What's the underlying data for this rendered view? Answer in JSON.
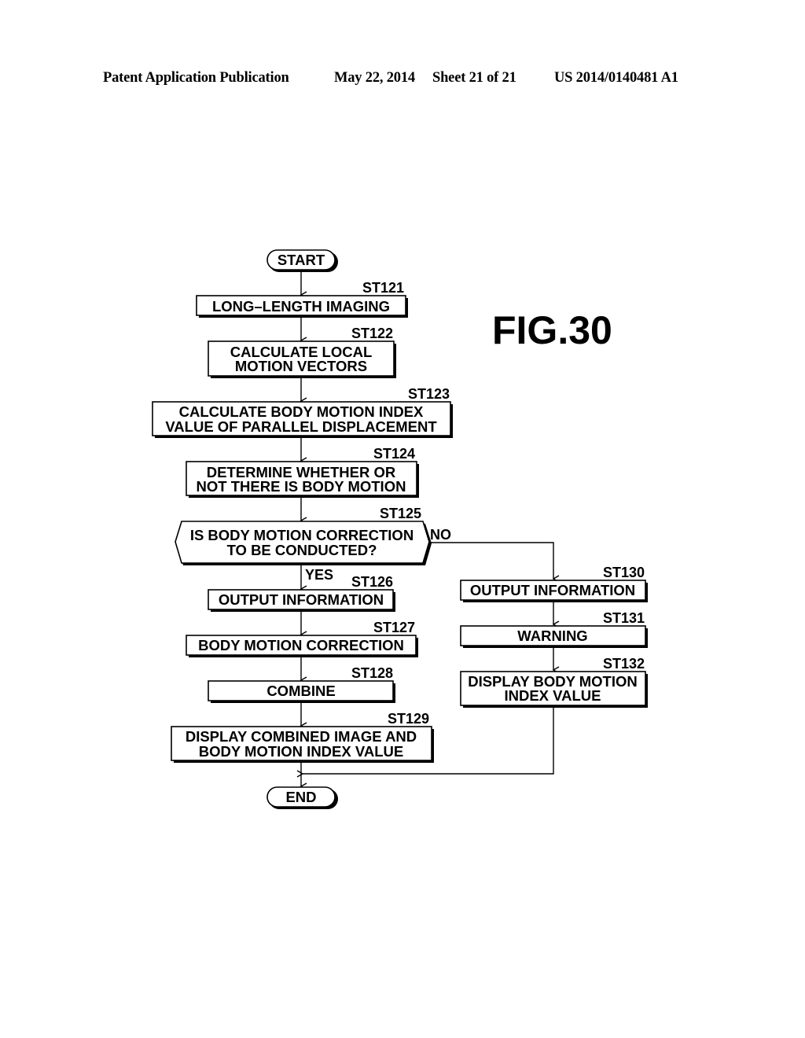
{
  "header": {
    "publication": "Patent Application Publication",
    "date": "May 22, 2014",
    "sheet": "Sheet 21 of 21",
    "number": "US 2014/0140481 A1"
  },
  "figure_label": "FIG.30",
  "flowchart": {
    "start": "START",
    "end": "END",
    "steps": {
      "st121": {
        "id": "ST121",
        "lines": [
          "LONG–LENGTH IMAGING"
        ]
      },
      "st122": {
        "id": "ST122",
        "lines": [
          "CALCULATE LOCAL",
          "MOTION VECTORS"
        ]
      },
      "st123": {
        "id": "ST123",
        "lines": [
          "CALCULATE BODY MOTION INDEX",
          "VALUE OF PARALLEL DISPLACEMENT"
        ]
      },
      "st124": {
        "id": "ST124",
        "lines": [
          "DETERMINE WHETHER OR",
          "NOT THERE IS BODY MOTION"
        ]
      },
      "st125": {
        "id": "ST125",
        "lines": [
          "IS BODY MOTION CORRECTION",
          "TO BE CONDUCTED?"
        ]
      },
      "st126": {
        "id": "ST126",
        "lines": [
          "OUTPUT INFORMATION"
        ]
      },
      "st127": {
        "id": "ST127",
        "lines": [
          "BODY MOTION CORRECTION"
        ]
      },
      "st128": {
        "id": "ST128",
        "lines": [
          "COMBINE"
        ]
      },
      "st129": {
        "id": "ST129",
        "lines": [
          "DISPLAY COMBINED IMAGE AND",
          "BODY MOTION INDEX VALUE"
        ]
      },
      "st130": {
        "id": "ST130",
        "lines": [
          "OUTPUT INFORMATION"
        ]
      },
      "st131": {
        "id": "ST131",
        "lines": [
          "WARNING"
        ]
      },
      "st132": {
        "id": "ST132",
        "lines": [
          "DISPLAY BODY MOTION",
          "INDEX VALUE"
        ]
      }
    },
    "branch_labels": {
      "yes": "YES",
      "no": "NO"
    }
  }
}
